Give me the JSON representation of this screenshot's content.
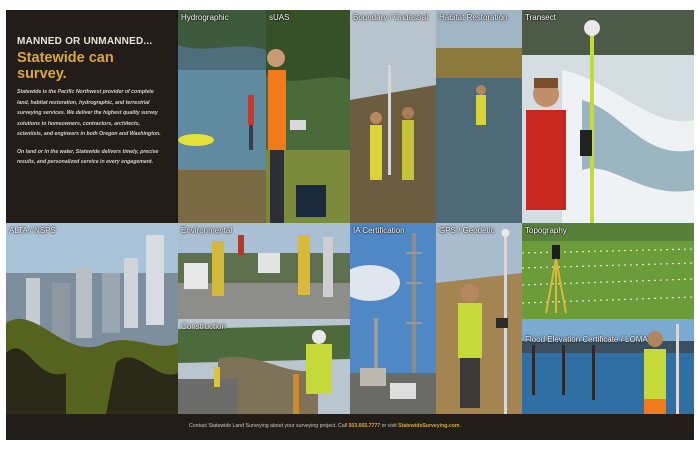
{
  "intro": {
    "kicker": "MANNED OR UNMANNED...",
    "headline": "Statewide can survey.",
    "paragraph_1": "Statewide is the Pacific Northwest provider of complete land, habitat restoration, hydrographic, and terrestrial surveying services. We deliver the highest quality survey solutions to homeowners, contractors, architects, scientists, and engineers in both Oregon and Washington.",
    "paragraph_2": "On land or in the water, Statewide delivers timely, precise results, and personalized service in every engagement."
  },
  "tiles": {
    "hydrographic": "Hydrographic",
    "suas": "sUAS",
    "boundary": "Boundary / Cadastral",
    "habitat": "Habitat Restoration",
    "transect": "Transect",
    "alta": "ALTA / NSPS",
    "environmental": "Environmental",
    "ia_certification": "IA Certification",
    "gps_geodetic": "GPS / Geodetic",
    "topography": "Topography",
    "construction": "Construction",
    "flood_elevation": "Flood Elevation Certificate / LOMA"
  },
  "footer": {
    "lead": "Contact Statewide Land Surveying about your surveying project. Call",
    "phone": "503.665.7777",
    "middle": "or visit",
    "website": "StatewideSurveying.com",
    "end": "."
  },
  "colors": {
    "accent_gold": "#d9a640",
    "panel_dark": "#231d1a",
    "hi_vis_green": "#c6d93a",
    "hi_vis_orange": "#f07a1c"
  }
}
